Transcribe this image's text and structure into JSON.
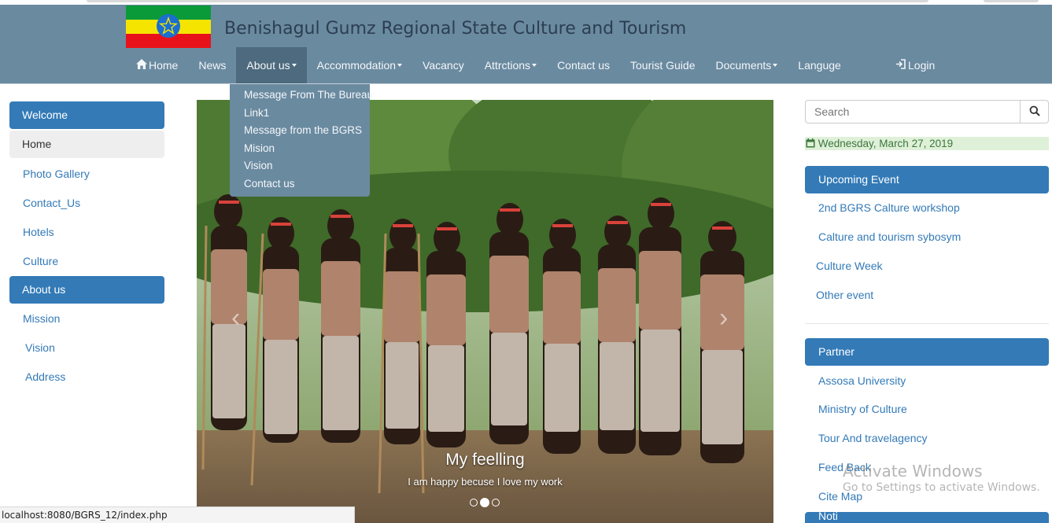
{
  "header": {
    "site_title": "Benishagul Gumz Regional State Culture and Tourism",
    "flag_colors": [
      "#0a9a3a",
      "#f5e400",
      "#e8121b",
      "#1a6fd0"
    ]
  },
  "nav": {
    "items": [
      {
        "label": "Home",
        "icon": "home-icon"
      },
      {
        "label": "News"
      },
      {
        "label": "About us",
        "dropdown": true
      },
      {
        "label": "Accommodation",
        "dropdown": true
      },
      {
        "label": "Vacancy"
      },
      {
        "label": "Attrctions",
        "dropdown": true
      },
      {
        "label": "Contact us"
      },
      {
        "label": "Tourist Guide"
      },
      {
        "label": "Documents",
        "dropdown": true
      },
      {
        "label": "Languge"
      }
    ],
    "login_label": "Login"
  },
  "dropdown": {
    "items": [
      "Message From The Bureau",
      "Link1",
      "Message from the BGRS",
      "Mision",
      "Vision",
      "Contact us"
    ]
  },
  "leftnav": {
    "welcome": "Welcome",
    "home": "Home",
    "links1": [
      "Photo Gallery",
      "Contact_Us",
      "Hotels",
      "Culture"
    ],
    "about_head": "About us",
    "links2": [
      "Mission",
      "Vision",
      "Address"
    ]
  },
  "carousel": {
    "caption_title": "My feelling",
    "caption_text": "I am happy becuse I love my work",
    "slides": 3,
    "active_slide": 2
  },
  "right": {
    "search_placeholder": "Search",
    "date": "Wednesday, March 27, 2019",
    "upcoming_head": "Upcoming Event",
    "upcoming": [
      "2nd BGRS Calture workshop",
      "Calture and tourism sybosym",
      "Culture Week",
      "Other event"
    ],
    "partner_head": "Partner",
    "partners": [
      "Assosa University",
      "Ministry of Culture",
      "Tour And travelagency",
      "Feed Back",
      "Cite Map"
    ],
    "next_head_partial": "Noti"
  },
  "statusbar": "localhost:8080/BGRS_12/index.php",
  "watermark": {
    "line1": "Activate Windows",
    "line2": "Go to Settings to activate Windows."
  }
}
